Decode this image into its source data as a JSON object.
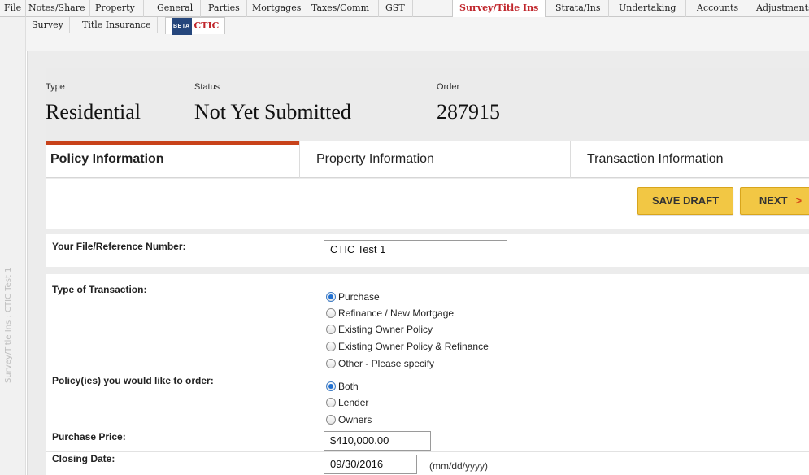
{
  "top_tabs": [
    {
      "label": "File"
    },
    {
      "label": "Notes/Share"
    },
    {
      "label": "Property"
    },
    {
      "label": "General"
    },
    {
      "label": "Parties"
    },
    {
      "label": "Mortgages"
    },
    {
      "label": "Taxes/Comm"
    },
    {
      "label": "GST"
    },
    {
      "label": "Survey/Title Ins",
      "active": true
    },
    {
      "label": "Strata/Ins"
    },
    {
      "label": "Undertaking"
    },
    {
      "label": "Accounts"
    },
    {
      "label": "Adjustments"
    }
  ],
  "sub_tabs": {
    "survey": "Survey",
    "title_insurance": "Title Insurance",
    "ctic_beta": "BETA",
    "ctic": "CTIC"
  },
  "side_label": "Survey/Title Ins : CTIC Test 1",
  "header": {
    "type_label": "Type",
    "type_value": "Residential",
    "status_label": "Status",
    "status_value": "Not Yet Submitted",
    "order_label": "Order",
    "order_value": "287915"
  },
  "steps": {
    "policy": "Policy Information",
    "property": "Property Information",
    "transaction": "Transaction Information"
  },
  "actions": {
    "save_draft": "SAVE DRAFT",
    "next": "NEXT",
    "next_chevron": ">"
  },
  "form": {
    "file_ref_label": "Your File/Reference Number:",
    "file_ref_value": "CTIC Test 1",
    "transaction_type_label": "Type of Transaction:",
    "transaction_options": [
      {
        "label": "Purchase",
        "selected": true
      },
      {
        "label": "Refinance / New Mortgage",
        "selected": false
      },
      {
        "label": "Existing Owner Policy",
        "selected": false
      },
      {
        "label": "Existing Owner Policy & Refinance",
        "selected": false
      },
      {
        "label": "Other - Please specify",
        "selected": false
      }
    ],
    "policies_label": "Policy(ies) you would like to order:",
    "policy_options": [
      {
        "label": "Both",
        "selected": true
      },
      {
        "label": "Lender",
        "selected": false
      },
      {
        "label": "Owners",
        "selected": false
      }
    ],
    "purchase_price_label": "Purchase Price:",
    "purchase_price_value": "$410,000.00",
    "closing_date_label": "Closing Date:",
    "closing_date_value": "09/30/2016",
    "closing_date_hint": "(mm/dd/yyyy)"
  },
  "colors": {
    "accent_red": "#c0262c",
    "step_bar": "#c8421a",
    "button_yellow": "#f2c744",
    "radio_blue": "#1f6fd1",
    "beta_badge": "#25467c"
  }
}
